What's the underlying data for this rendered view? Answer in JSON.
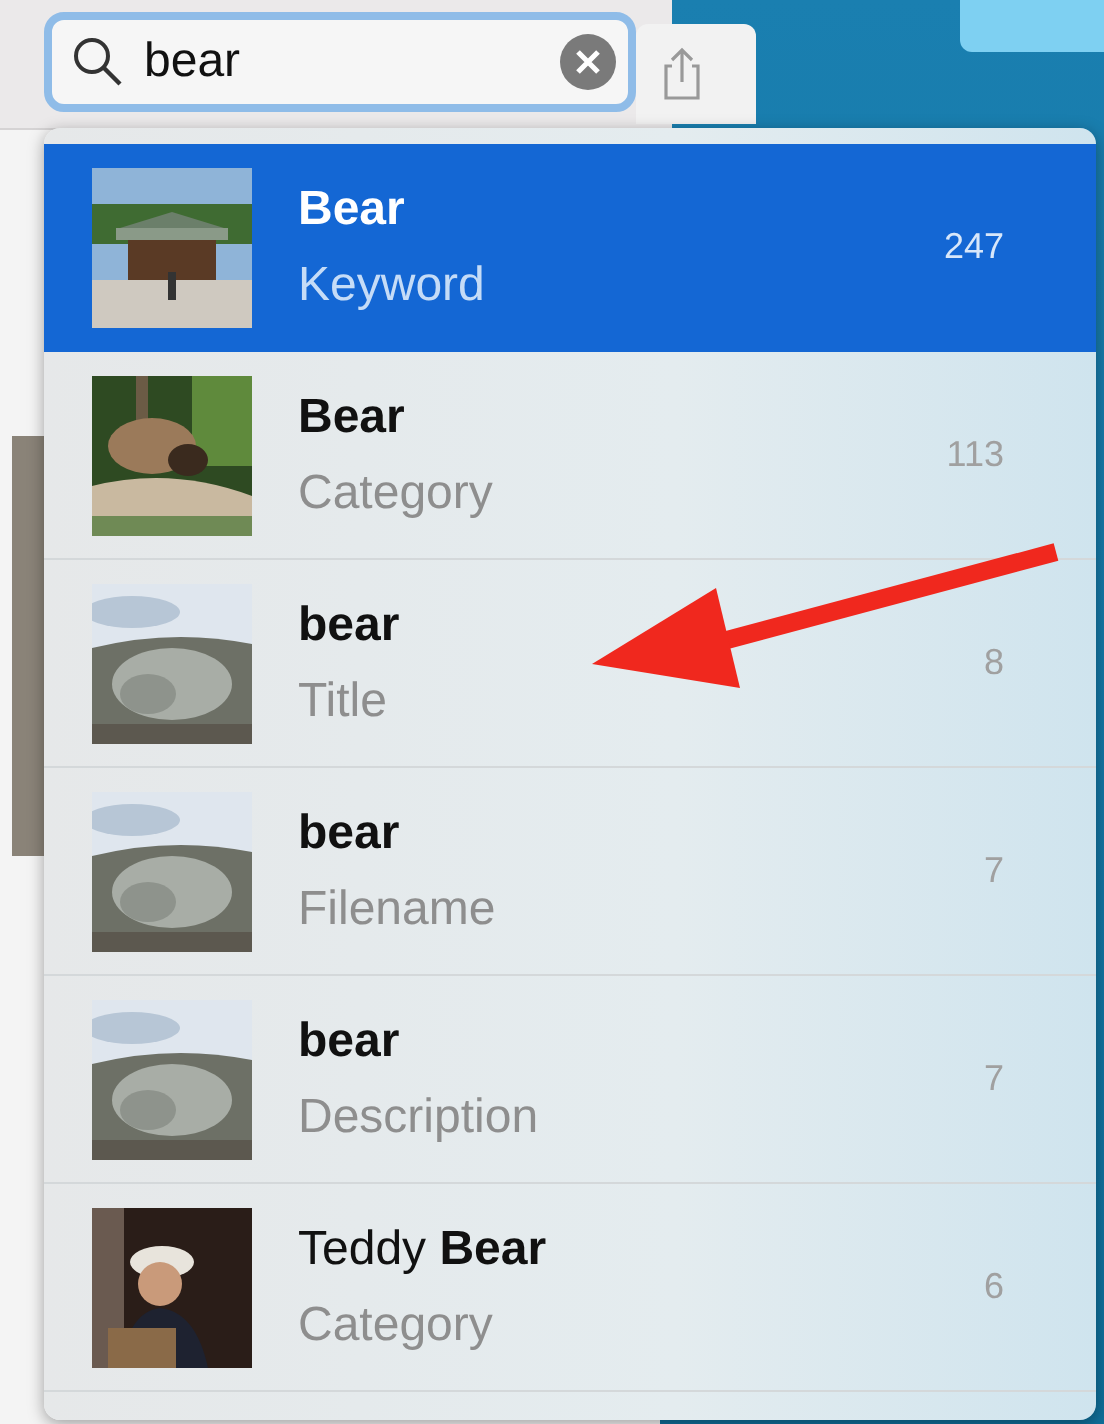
{
  "search": {
    "value": "bear"
  },
  "results": [
    {
      "title": "**Bear**",
      "type": "Keyword",
      "count": "247",
      "selected": true
    },
    {
      "title": "**Bear**",
      "type": "Category",
      "count": "113",
      "selected": false
    },
    {
      "title": "**bear**",
      "type": "Title",
      "count": "8",
      "selected": false
    },
    {
      "title": "**bear**",
      "type": "Filename",
      "count": "7",
      "selected": false
    },
    {
      "title": "**bear**",
      "type": "Description",
      "count": "7",
      "selected": false
    },
    {
      "title": "Teddy **Bear**",
      "type": "Category",
      "count": "6",
      "selected": false
    }
  ]
}
